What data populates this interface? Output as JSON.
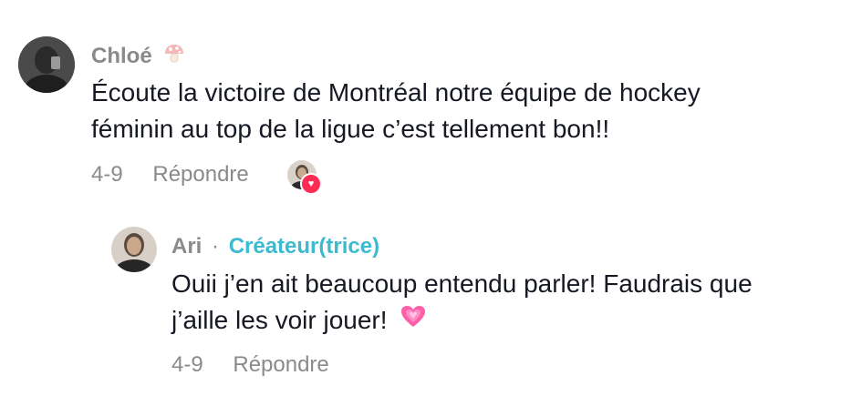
{
  "comment": {
    "username": "Chloé",
    "username_emoji": "mushroom-icon",
    "text_lines": [
      "Écoute la victoire de Montréal notre équipe de hockey",
      "féminin au top de la ligue c’est tellement bon!!"
    ],
    "date": "4-9",
    "reply_label": "Répondre",
    "liked_by_creator": true,
    "like_badge_icon": "heart-icon"
  },
  "reply": {
    "username": "Ari",
    "separator": "·",
    "creator_label": "Créateur(trice)",
    "text_lines": [
      "Ouii j’en ait beaucoup entendu parler! Faudrais que",
      "j’aille les voir jouer!"
    ],
    "trailing_emoji": "growing-heart-icon",
    "date": "4-9",
    "reply_label": "Répondre"
  },
  "colors": {
    "meta_gray": "#8a8a8a",
    "text_dark": "#161823",
    "creator_teal": "#3cbbd0",
    "like_badge": "#fe2c55",
    "heart_pink": "#ff5fa8"
  }
}
